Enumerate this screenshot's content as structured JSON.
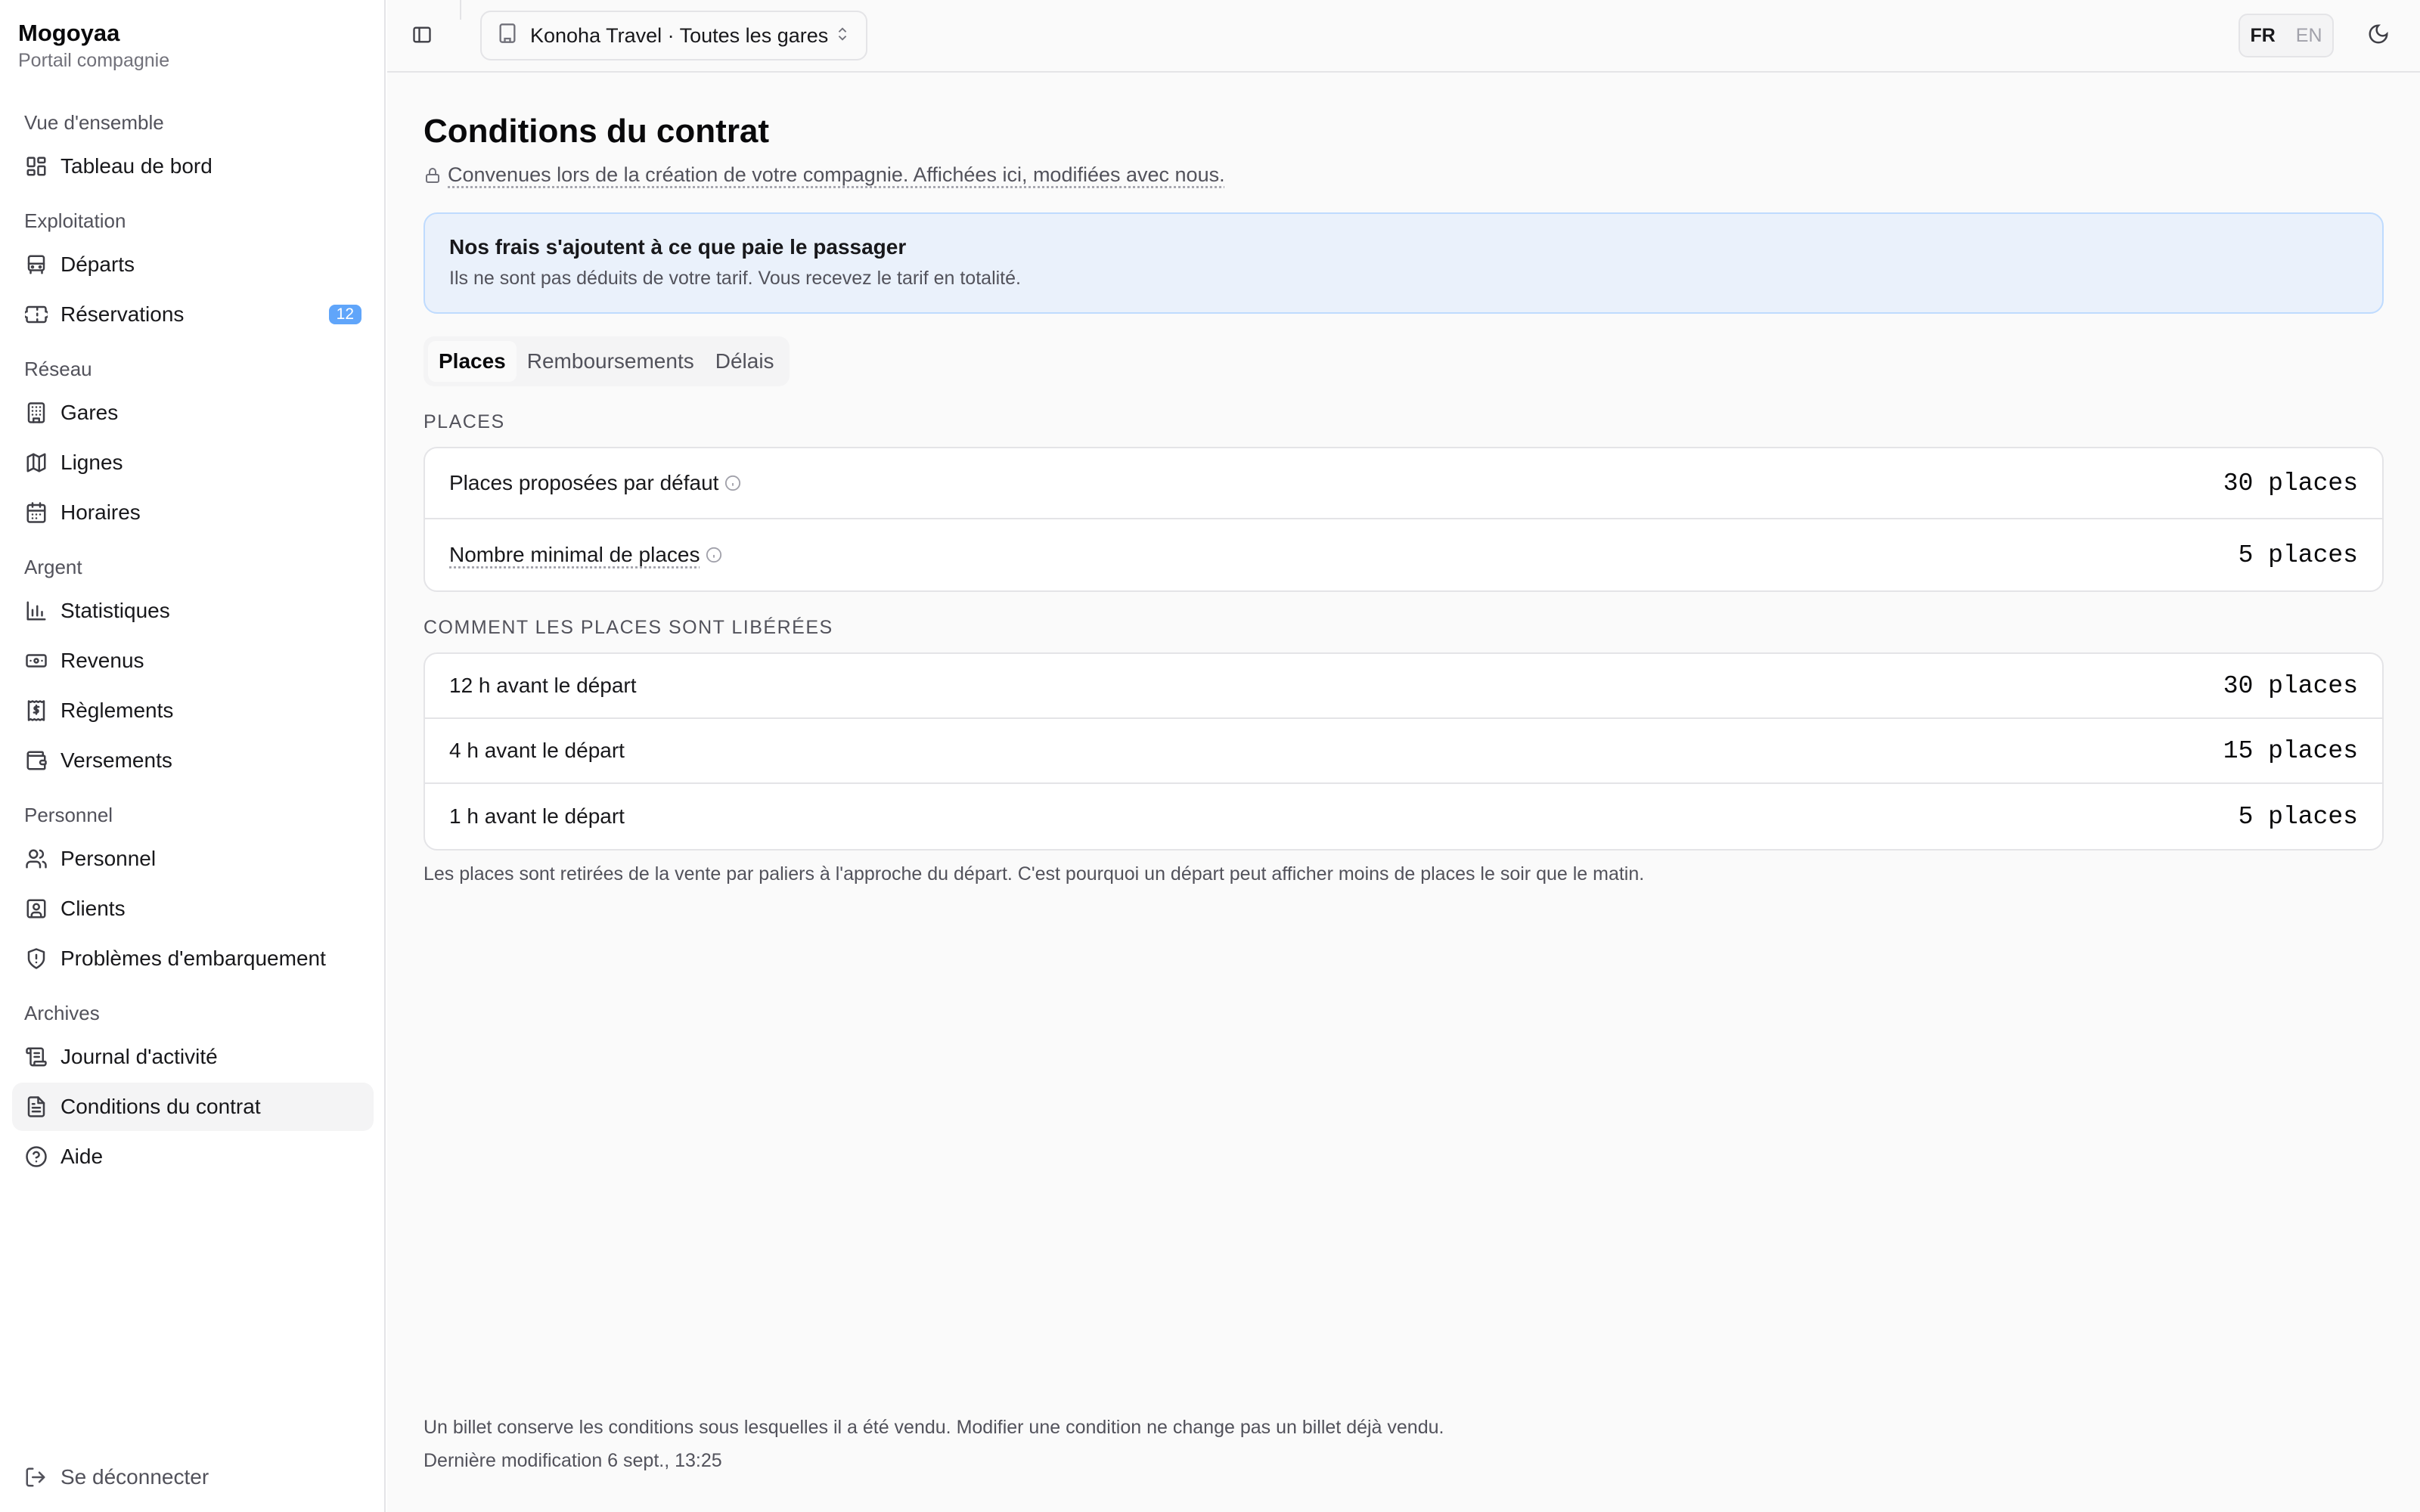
{
  "brand": {
    "name": "Mogoyaa",
    "subtitle": "Portail compagnie"
  },
  "sidebar": {
    "groups": [
      {
        "label": "Vue d'ensemble",
        "items": [
          {
            "label": "Tableau de bord",
            "icon": "dashboard-icon"
          }
        ]
      },
      {
        "label": "Exploitation",
        "items": [
          {
            "label": "Départs",
            "icon": "bus-icon"
          },
          {
            "label": "Réservations",
            "icon": "ticket-icon",
            "badge": "12"
          }
        ]
      },
      {
        "label": "Réseau",
        "items": [
          {
            "label": "Gares",
            "icon": "building-icon"
          },
          {
            "label": "Lignes",
            "icon": "map-icon"
          },
          {
            "label": "Horaires",
            "icon": "calendar-icon"
          }
        ]
      },
      {
        "label": "Argent",
        "items": [
          {
            "label": "Statistiques",
            "icon": "bar-chart-icon"
          },
          {
            "label": "Revenus",
            "icon": "banknote-icon"
          },
          {
            "label": "Règlements",
            "icon": "receipt-icon"
          },
          {
            "label": "Versements",
            "icon": "wallet-icon"
          }
        ]
      },
      {
        "label": "Personnel",
        "items": [
          {
            "label": "Personnel",
            "icon": "users-icon"
          },
          {
            "label": "Clients",
            "icon": "contact-icon"
          },
          {
            "label": "Problèmes d'embarquement",
            "icon": "shield-icon"
          }
        ]
      },
      {
        "label": "Archives",
        "items": [
          {
            "label": "Journal d'activité",
            "icon": "scroll-icon"
          },
          {
            "label": "Conditions du contrat",
            "icon": "file-text-icon",
            "active": true
          },
          {
            "label": "Aide",
            "icon": "help-circle-icon"
          }
        ]
      }
    ],
    "logout_label": "Se déconnecter"
  },
  "topbar": {
    "company_select": "Konoha Travel · Toutes les gares",
    "lang_fr": "FR",
    "lang_en": "EN"
  },
  "page": {
    "title": "Conditions du contrat",
    "subtitle": "Convenues lors de la création de votre compagnie. Affichées ici, modifiées avec nous."
  },
  "notice": {
    "title": "Nos frais s'ajoutent à ce que paie le passager",
    "body": "Ils ne sont pas déduits de votre tarif. Vous recevez le tarif en totalité."
  },
  "tabs": [
    "Places",
    "Remboursements",
    "Délais"
  ],
  "places": {
    "section_label": "Places",
    "rows": [
      {
        "label": "Places proposées par défaut",
        "value": "30 places"
      },
      {
        "label": "Nombre minimal de places",
        "value": "5 places"
      }
    ]
  },
  "release": {
    "section_label": "Comment les places sont libérées",
    "rows": [
      {
        "label": "12 h avant le départ",
        "value": "30 places"
      },
      {
        "label": "4 h avant le départ",
        "value": "15 places"
      },
      {
        "label": "1 h avant le départ",
        "value": "5 places"
      }
    ],
    "note": "Les places sont retirées de la vente par paliers à l'approche du départ. C'est pourquoi un départ peut afficher moins de places le soir que le matin."
  },
  "footer": {
    "line1": "Un billet conserve les conditions sous lesquelles il a été vendu. Modifier une condition ne change pas un billet déjà vendu.",
    "line2": "Dernière modification 6 sept., 13:25"
  },
  "colors": {
    "accent_badge": "#60a5fa",
    "notice_bg": "#eaf1fb",
    "notice_border": "#bfdbfe"
  }
}
